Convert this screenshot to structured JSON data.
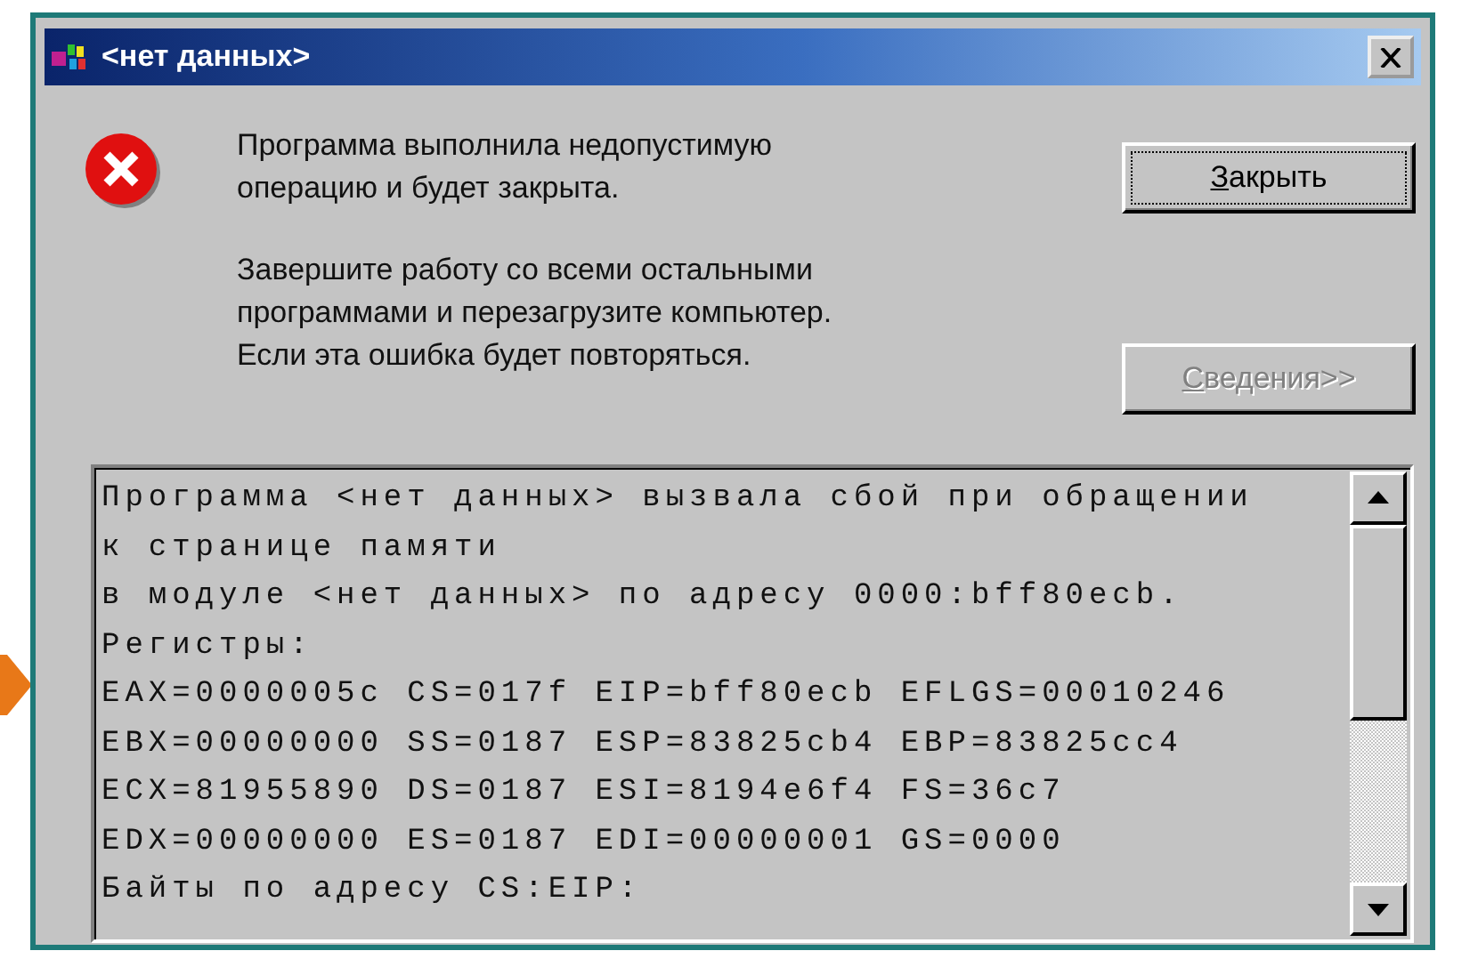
{
  "window": {
    "title": "<нет данных>"
  },
  "message": {
    "paragraphs": [
      [
        "Программа выполнила недопустимую",
        "операцию и будет закрыта."
      ],
      [
        "Завершите работу со всеми остальными",
        "программами и перезагрузите компьютер.",
        "Если эта ошибка будет повторяться."
      ]
    ]
  },
  "buttons": [
    {
      "label": "Закрыть",
      "focused": true,
      "disabled": false
    },
    {
      "label": "Сведения>>",
      "focused": false,
      "disabled": true
    }
  ],
  "details": {
    "lines": [
      "Программа <нет данных> вызвала сбой при обращении",
      "к странице памяти",
      "в модуле <нет данных> по адресу 0000:bff80ecb.",
      "Регистры:",
      "EAX=0000005c CS=017f EIP=bff80ecb EFLGS=00010246",
      "EBX=00000000 SS=0187 ESP=83825cb4 EBP=83825cc4",
      "ECX=81955890 DS=0187 ESI=8194e6f4 FS=36c7",
      "EDX=00000000 ES=0187 EDI=00000001 GS=0000",
      "Байты по адресу CS:EIP:"
    ]
  }
}
